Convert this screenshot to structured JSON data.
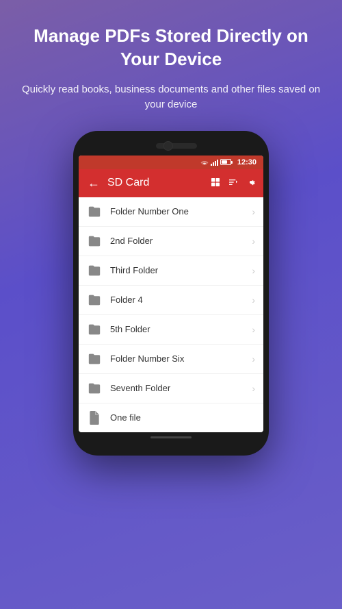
{
  "header": {
    "title": "Manage PDFs Stored Directly on Your Device",
    "subtitle": "Quickly read books, business documents and other files saved on your device"
  },
  "statusBar": {
    "time": "12:30"
  },
  "appBar": {
    "title": "SD Card",
    "backLabel": "←"
  },
  "files": [
    {
      "id": 1,
      "name": "Folder Number One",
      "type": "folder"
    },
    {
      "id": 2,
      "name": "2nd Folder",
      "type": "folder"
    },
    {
      "id": 3,
      "name": "Third Folder",
      "type": "folder"
    },
    {
      "id": 4,
      "name": "Folder 4",
      "type": "folder"
    },
    {
      "id": 5,
      "name": "5th Folder",
      "type": "folder"
    },
    {
      "id": 6,
      "name": "Folder Number Six",
      "type": "folder"
    },
    {
      "id": 7,
      "name": "Seventh Folder",
      "type": "folder"
    },
    {
      "id": 8,
      "name": "One file",
      "type": "file"
    }
  ]
}
